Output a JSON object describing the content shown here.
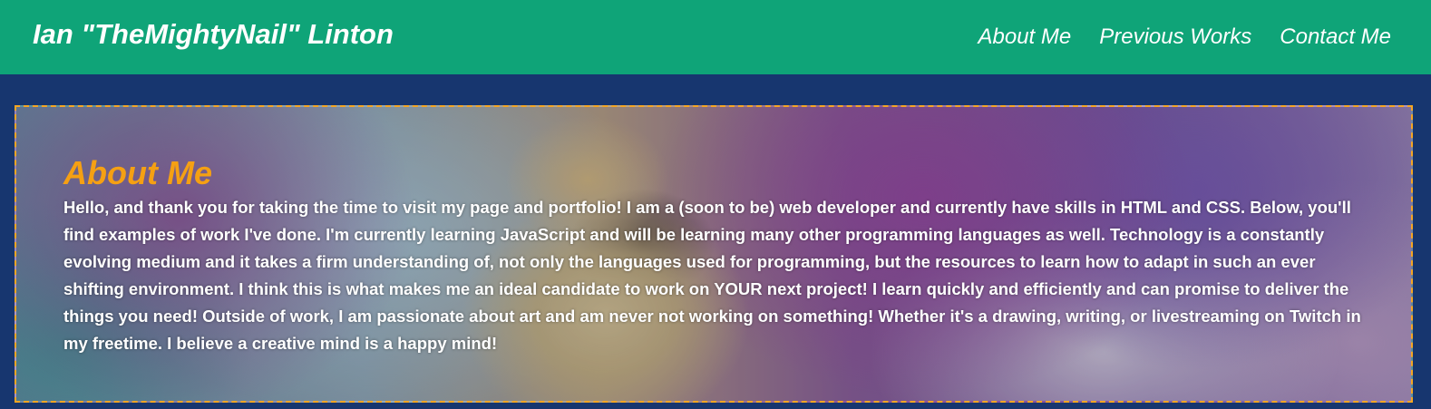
{
  "header": {
    "site_title": "Ian \"TheMightyNail\" Linton",
    "nav": [
      {
        "label": "About Me"
      },
      {
        "label": "Previous Works"
      },
      {
        "label": "Contact Me"
      }
    ]
  },
  "about": {
    "heading": "About Me",
    "body": "Hello, and thank you for taking the time to visit my page and portfolio! I am a (soon to be) web developer and currently have skills in HTML and CSS. Below, you'll find examples of work I've done. I'm currently learning JavaScript and will be learning many other programming languages as well. Technology is a constantly evolving medium and it takes a firm understanding of, not only the languages used for programming, but the resources to learn how to adapt in such an ever shifting environment. I think this is what makes me an ideal candidate to work on YOUR next project! I learn quickly and efficiently and can promise to deliver the things you need! Outside of work, I am passionate about art and am never not working on something! Whether it's a drawing, writing, or livestreaming on Twitch in my freetime. I believe a creative mind is a happy mind!"
  },
  "colors": {
    "header_bg": "#0fa478",
    "page_bg": "#17366f",
    "heading_accent": "#f5a013",
    "panel_border": "#f5a623"
  }
}
